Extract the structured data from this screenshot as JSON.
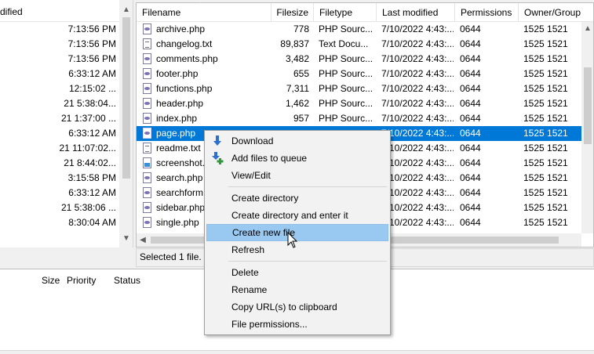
{
  "left_pane": {
    "header": "dified",
    "rows": [
      "7:13:56 PM",
      "7:13:56 PM",
      "7:13:56 PM",
      "6:33:12 AM",
      "12:15:02 ...",
      "21 5:38:04...",
      "21 1:37:00 ...",
      "6:33:12 AM",
      "21 11:07:02...",
      "21 8:44:02...",
      "3:15:58 PM",
      "6:33:12 AM",
      "21 5:38:06 ...",
      "8:30:04 AM"
    ]
  },
  "remote": {
    "columns": {
      "filename": "Filename",
      "filesize": "Filesize",
      "filetype": "Filetype",
      "last_modified": "Last modified",
      "permissions": "Permissions",
      "owner_group": "Owner/Group"
    },
    "files": [
      {
        "name": "archive.php",
        "icon": "php-file-icon",
        "size": "778",
        "type": "PHP Sourc...",
        "modified": "7/10/2022 4:43:...",
        "perms": "0644",
        "owner": "1525 1521"
      },
      {
        "name": "changelog.txt",
        "icon": "text-file-icon",
        "size": "89,837",
        "type": "Text Docu...",
        "modified": "7/10/2022 4:43:...",
        "perms": "0644",
        "owner": "1525 1521"
      },
      {
        "name": "comments.php",
        "icon": "php-file-icon",
        "size": "3,482",
        "type": "PHP Sourc...",
        "modified": "7/10/2022 4:43:...",
        "perms": "0644",
        "owner": "1525 1521"
      },
      {
        "name": "footer.php",
        "icon": "php-file-icon",
        "size": "655",
        "type": "PHP Sourc...",
        "modified": "7/10/2022 4:43:...",
        "perms": "0644",
        "owner": "1525 1521"
      },
      {
        "name": "functions.php",
        "icon": "php-file-icon",
        "size": "7,311",
        "type": "PHP Sourc...",
        "modified": "7/10/2022 4:43:...",
        "perms": "0644",
        "owner": "1525 1521"
      },
      {
        "name": "header.php",
        "icon": "php-file-icon",
        "size": "1,462",
        "type": "PHP Sourc...",
        "modified": "7/10/2022 4:43:...",
        "perms": "0644",
        "owner": "1525 1521"
      },
      {
        "name": "index.php",
        "icon": "php-file-icon",
        "size": "957",
        "type": "PHP Sourc...",
        "modified": "7/10/2022 4:43:...",
        "perms": "0644",
        "owner": "1525 1521"
      },
      {
        "name": "page.php",
        "icon": "php-file-icon",
        "size": "",
        "type": "",
        "modified": "7/10/2022 4:43:...",
        "perms": "0644",
        "owner": "1525 1521",
        "selected": true
      },
      {
        "name": "readme.txt",
        "icon": "text-file-icon",
        "size": "",
        "type": "",
        "modified": "7/10/2022 4:43:...",
        "perms": "0644",
        "owner": "1525 1521"
      },
      {
        "name": "screenshot.j",
        "icon": "image-file-icon",
        "size": "",
        "type": "",
        "modified": "7/10/2022 4:43:...",
        "perms": "0644",
        "owner": "1525 1521"
      },
      {
        "name": "search.php",
        "icon": "php-file-icon",
        "size": "",
        "type": "",
        "modified": "7/10/2022 4:43:...",
        "perms": "0644",
        "owner": "1525 1521"
      },
      {
        "name": "searchform.",
        "icon": "php-file-icon",
        "size": "",
        "type": "",
        "modified": "7/10/2022 4:43:...",
        "perms": "0644",
        "owner": "1525 1521"
      },
      {
        "name": "sidebar.php",
        "icon": "php-file-icon",
        "size": "",
        "type": "",
        "modified": "7/10/2022 4:43:...",
        "perms": "0644",
        "owner": "1525 1521"
      },
      {
        "name": "single.php",
        "icon": "php-file-icon",
        "size": "",
        "type": "",
        "modified": "7/10/2022 4:43:...",
        "perms": "0644",
        "owner": "1525 1521"
      }
    ],
    "status": "Selected 1 file. T"
  },
  "queue": {
    "columns": {
      "size": "Size",
      "priority": "Priority",
      "status": "Status"
    }
  },
  "context_menu": {
    "items": [
      {
        "label": "Download",
        "icon": "download-arrow-icon"
      },
      {
        "label": "Add files to queue",
        "icon": "add-to-queue-icon"
      },
      {
        "label": "View/Edit"
      },
      {
        "label": "Create directory"
      },
      {
        "label": "Create directory and enter it"
      },
      {
        "label": "Create new file",
        "highlighted": true
      },
      {
        "label": "Refresh"
      },
      {
        "label": "Delete"
      },
      {
        "label": "Rename"
      },
      {
        "label": "Copy URL(s) to clipboard"
      },
      {
        "label": "File permissions..."
      }
    ]
  },
  "colors": {
    "selection": "#0078d7",
    "menu_highlight": "#99c8f0",
    "window_bg": "#f0f0f0"
  }
}
